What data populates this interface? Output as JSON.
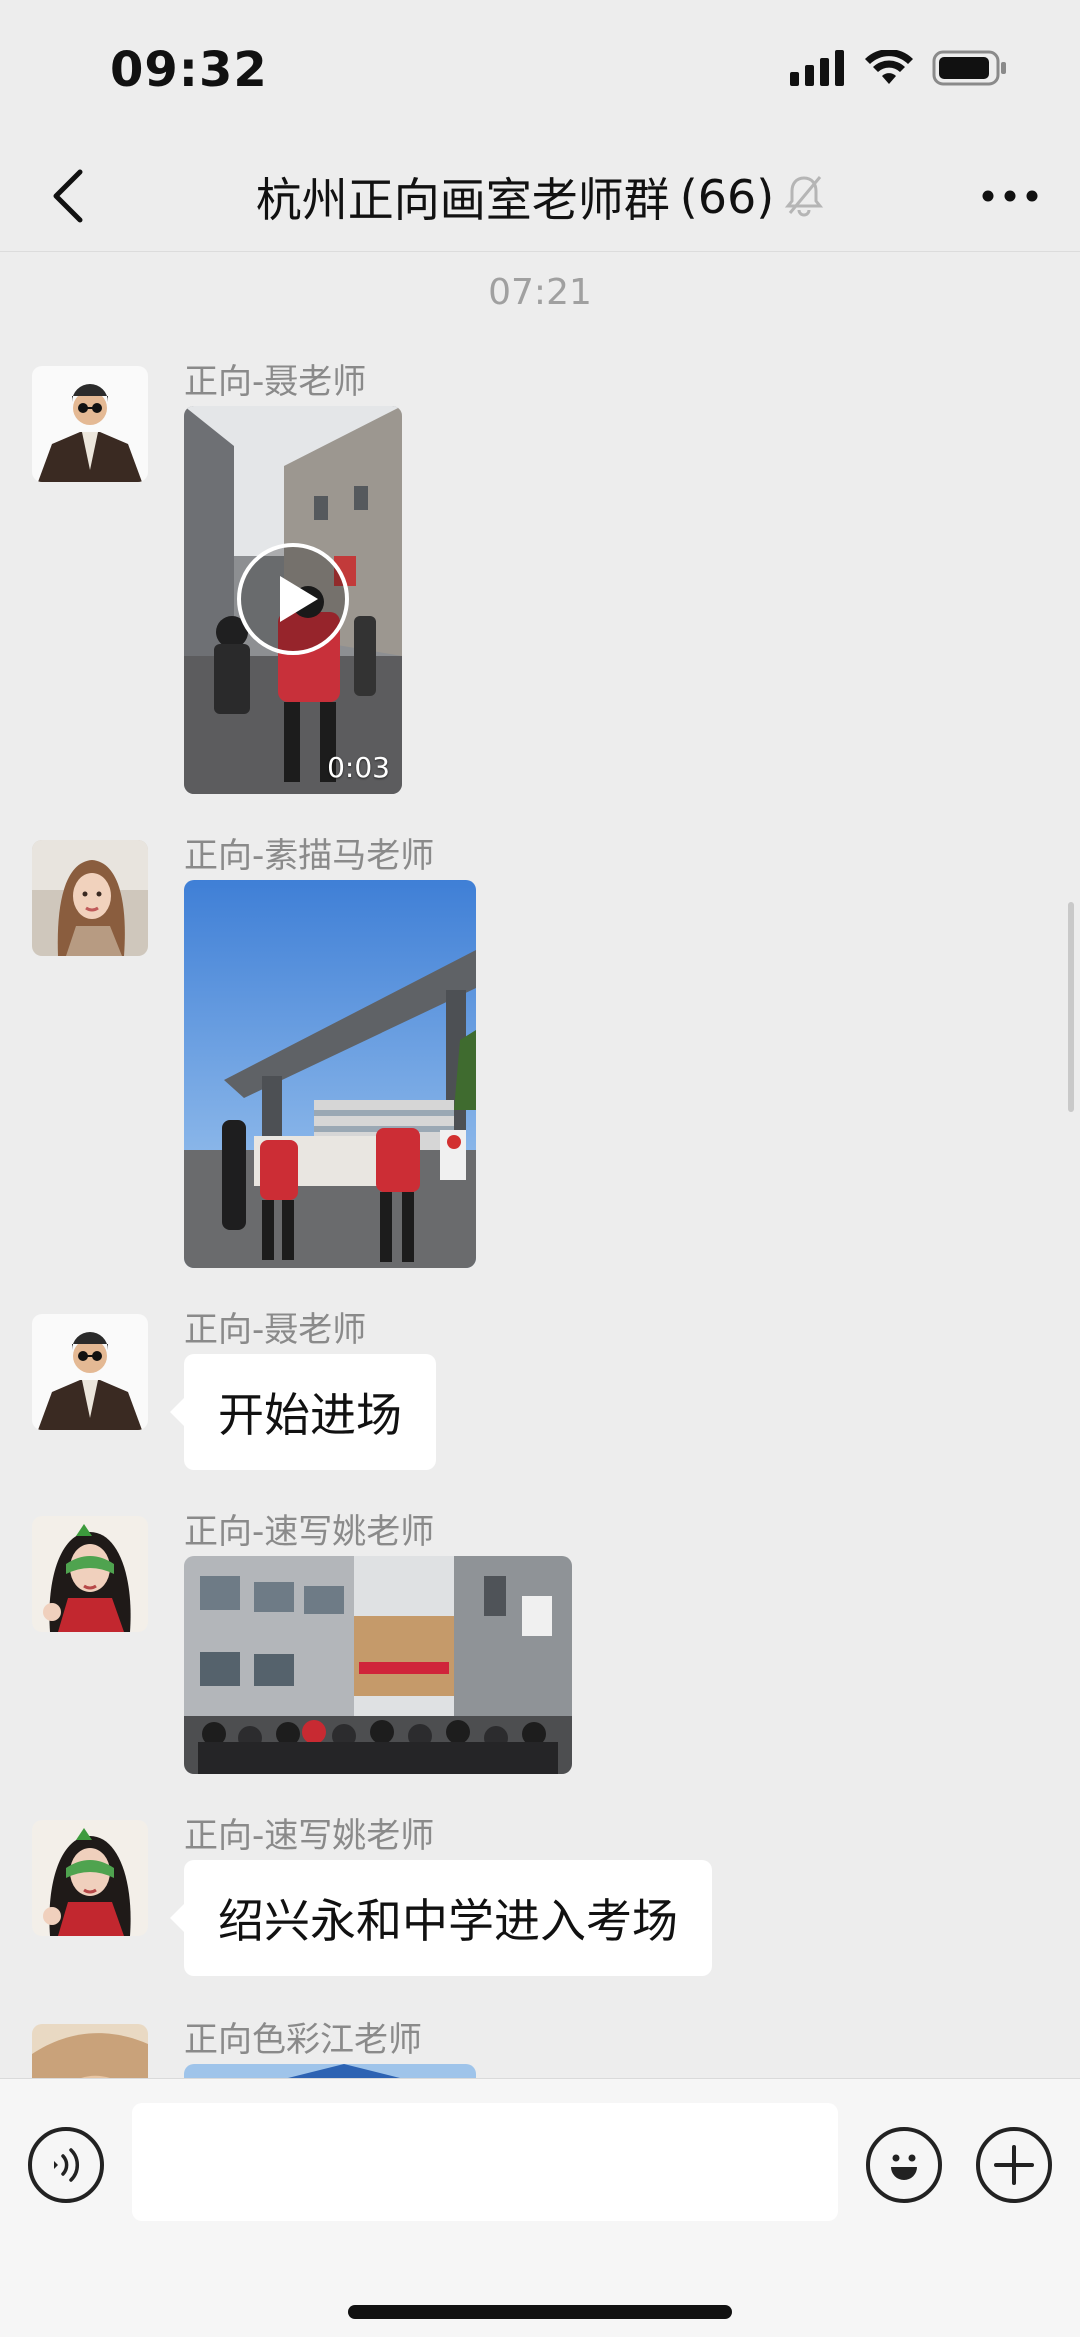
{
  "status_bar": {
    "time": "09:32",
    "icons": [
      "signal-icon",
      "wifi-icon",
      "battery-icon"
    ]
  },
  "header": {
    "title": "杭州正向画室老师群",
    "member_count": "(66)",
    "icons": [
      "back-icon",
      "mute-bell-icon",
      "more-icon"
    ]
  },
  "chat": {
    "timestamp": "07:21",
    "messages": [
      {
        "sender": "正向-聂老师",
        "type": "video",
        "duration": "0:03"
      },
      {
        "sender": "正向-素描马老师",
        "type": "image"
      },
      {
        "sender": "正向-聂老师",
        "type": "text",
        "text": "开始进场"
      },
      {
        "sender": "正向-速写姚老师",
        "type": "image"
      },
      {
        "sender": "正向-速写姚老师",
        "type": "text",
        "text": "绍兴永和中学进入考场"
      },
      {
        "sender": "正向色彩江老师",
        "type": "image"
      }
    ]
  },
  "input_bar": {
    "input_value": "",
    "icons": [
      "voice-icon",
      "emoji-icon",
      "plus-icon"
    ]
  }
}
